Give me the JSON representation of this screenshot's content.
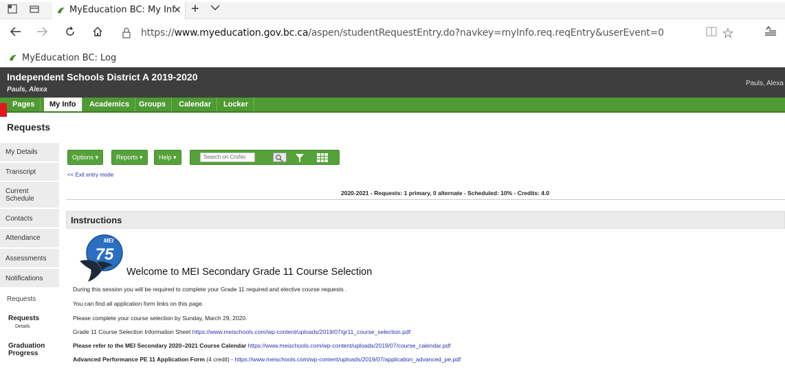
{
  "browser": {
    "tab_title": "MyEducation BC: My Inf",
    "tab_close": "✕",
    "new_tab": "+",
    "url_prefix": "https://",
    "url_domain": "www.myeducation.gov.bc.ca",
    "url_path": "/aspen/studentRequestEntry.do?navkey=myInfo.req.reqEntry&userEvent=0",
    "favorite_label": "MyEducation BC: Log",
    "icons": [
      "tab-actions-icon",
      "tab-preview-icon",
      "back-icon",
      "forward-icon",
      "refresh-icon",
      "home-icon",
      "lock-icon",
      "reading-view-icon",
      "favorite-star-icon",
      "hub-icon"
    ]
  },
  "header": {
    "district": "Independent Schools District A 2019-2020",
    "user": "Pauls, Alexa",
    "user_right": "Pauls, Alexa"
  },
  "nav": {
    "tabs": [
      {
        "label": "Pages"
      },
      {
        "label": "My Info"
      },
      {
        "label": "Academics"
      },
      {
        "label": "Groups"
      },
      {
        "label": "Calendar"
      },
      {
        "label": "Locker"
      }
    ],
    "active": "My Info"
  },
  "page": {
    "title": "Requests"
  },
  "sidebar": {
    "items": [
      {
        "label": "My Details"
      },
      {
        "label": "Transcript"
      },
      {
        "label": "Current",
        "label2": "Schedule"
      },
      {
        "label": "Contacts"
      },
      {
        "label": "Attendance"
      },
      {
        "label": "Assessments"
      },
      {
        "label": "Notifications"
      }
    ],
    "section_label": "Requests",
    "sub_items": [
      {
        "label": "Requests",
        "sub": "Details"
      },
      {
        "label": "Graduation",
        "label2": "Progress"
      }
    ]
  },
  "toolbar": {
    "options_label": "Options ▾",
    "reports_label": "Reports ▾",
    "help_label": "Help ▾",
    "search_placeholder": "Search on CrsNo"
  },
  "exit_link": "<< Exit entry mode",
  "summary": "2020-2021 - Requests: 1 primary, 0 alternate - Scheduled: 10% - Credits: 4.0",
  "instructions": {
    "title": "Instructions",
    "logo_text": "75",
    "logo_small": "MEI",
    "welcome": "Welcome to MEI Secondary Grade 11 Course Selection",
    "lines": [
      {
        "text": "During this session you will be required to complete your Grade 11 required and elective course requests ."
      },
      {
        "text": "You can find all application form links on this page."
      },
      {
        "text": "Please complete your course selection by Sunday, March 29, 2020."
      },
      {
        "text": "Grade 11 Course Selection Information Sheet",
        "link": "https://www.meischools.com/wp-content/uploads/2019/07/gr11_course_selection.pdf"
      },
      {
        "bold": "Please refer to the MEI Secondary 2020–2021 Course Calendar",
        "link": "https://www.meischools.com/wp-content/uploads/2019/07/course_calendar.pdf"
      },
      {
        "bold": "Advanced Performance PE 11 Application Form",
        "text": " (4 credit) - ",
        "link": "https://www.meischools.com/wp-content/uploads/2019/07/application_advanced_pe.pdf"
      }
    ]
  }
}
